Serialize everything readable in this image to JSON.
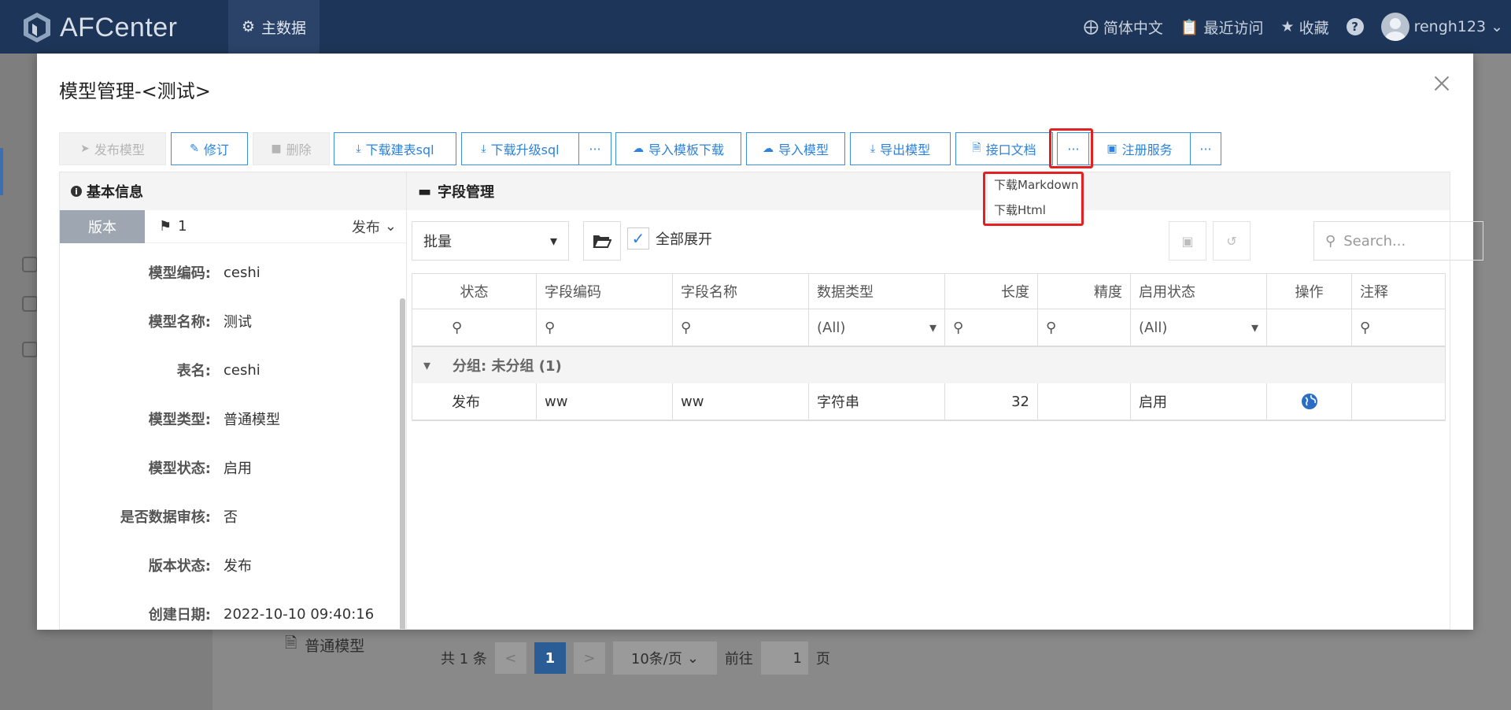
{
  "app": {
    "name": "AFCenter",
    "nav_main": "主数据"
  },
  "topbar": {
    "lang": "简体中文",
    "recent": "最近访问",
    "favorites": "收藏",
    "help": "?",
    "user": "rengh123"
  },
  "background": {
    "tree_item": "普通模型",
    "pager": {
      "total": "共 1 条",
      "prev": "<",
      "current": "1",
      "next": ">",
      "size": "10条/页",
      "goto_label": "前往",
      "goto_value": "1",
      "page_suffix": "页"
    }
  },
  "modal": {
    "title": "模型管理-<测试>",
    "toolbar": {
      "publish": "发布模型",
      "revise": "修订",
      "delete": "删除",
      "download_create_sql": "下载建表sql",
      "download_upgrade_sql": "下载升级sql",
      "more1": "···",
      "import_template_download": "导入模板下载",
      "import_model": "导入模型",
      "export_model": "导出模型",
      "api_doc": "接口文档",
      "more2": "···",
      "register_service": "注册服务",
      "more3": "···"
    },
    "dropdown": {
      "items": [
        "下载Markdown",
        "下载Html"
      ]
    },
    "basic_info": {
      "title": "基本信息",
      "version_tab": "版本",
      "version_num": "1",
      "version_status_select": "发布",
      "fields": [
        {
          "label": "模型编码:",
          "value": "ceshi"
        },
        {
          "label": "模型名称:",
          "value": "测试"
        },
        {
          "label": "表名:",
          "value": "ceshi"
        },
        {
          "label": "模型类型:",
          "value": "普通模型"
        },
        {
          "label": "模型状态:",
          "value": "启用"
        },
        {
          "label": "是否数据审核:",
          "value": "否"
        },
        {
          "label": "版本状态:",
          "value": "发布"
        },
        {
          "label": "创建日期:",
          "value": "2022-10-10 09:40:16"
        }
      ]
    },
    "field_mgmt": {
      "title": "字段管理",
      "batch": "批量",
      "expand_all": "全部展开",
      "search_placeholder": "Search...",
      "columns": [
        "状态",
        "字段编码",
        "字段名称",
        "数据类型",
        "长度",
        "精度",
        "启用状态",
        "操作",
        "注释"
      ],
      "filters": {
        "data_type": "(All)",
        "enable_status": "(All)"
      },
      "group_label": "分组: 未分组 (1)",
      "rows": [
        {
          "status": "发布",
          "code": "ww",
          "name": "ww",
          "type": "字符串",
          "length": "32",
          "precision": "",
          "enabled": "启用",
          "note": ""
        }
      ]
    }
  }
}
